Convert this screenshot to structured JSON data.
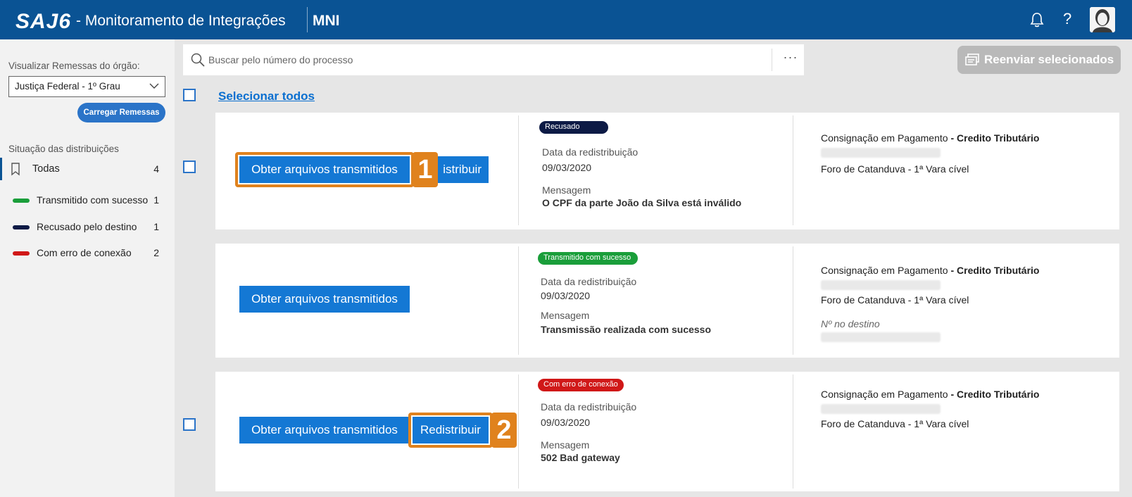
{
  "header": {
    "brand": "SAJ6",
    "title": "- Monitoramento de Integrações",
    "app_code": "MNI",
    "help_label": "?"
  },
  "sidebar": {
    "org_label": "Visualizar Remessas do órgão:",
    "org_value": "Justiça Federal - 1º Grau",
    "load_button": "Carregar Remessas",
    "status_label": "Situação das distribuições",
    "filters": [
      {
        "label": "Todas",
        "count": "4",
        "color": ""
      },
      {
        "label": "Transmitido com sucesso",
        "count": "1",
        "color": "#1a9e3a"
      },
      {
        "label": "Recusado pelo destino",
        "count": "1",
        "color": "#0d1a45"
      },
      {
        "label": "Com erro de conexão",
        "count": "2",
        "color": "#d01818"
      }
    ]
  },
  "search": {
    "placeholder": "Buscar pelo número do processo",
    "more_label": "···"
  },
  "toolbar": {
    "resend_label": "Reenviar selecionados"
  },
  "list": {
    "select_all": "Selecionar todos",
    "items": [
      {
        "obtain_label": "Obter arquivos transmitidos",
        "redistribute_label": "Redistribuir",
        "redistribute_visible_text": "istribuir",
        "callout_number": "1",
        "status_badge": "Recusado",
        "status_color": "#0d1a45",
        "date_label": "Data da redistribuição",
        "date_value": "09/03/2020",
        "message_label": "Mensagem",
        "message_value": "O CPF da parte João da Silva está inválido",
        "class_name": "Consignação em Pagamento",
        "class_subject": "- Credito Tributário",
        "court": "Foro de Catanduva - 1ª Vara cível"
      },
      {
        "obtain_label": "Obter arquivos transmitidos",
        "status_badge": "Transmitido com sucesso",
        "status_color": "#1a9e3a",
        "date_label": "Data da redistribuição",
        "date_value": "09/03/2020",
        "message_label": "Mensagem",
        "message_value": "Transmissão realizada com sucesso",
        "class_name": "Consignação em Pagamento",
        "class_subject": "- Credito Tributário",
        "court": "Foro de Catanduva - 1ª Vara cível",
        "dest_label": "Nº no destino"
      },
      {
        "obtain_label": "Obter arquivos transmitidos",
        "redistribute_label": "Redistribuir",
        "callout_number": "2",
        "status_badge": "Com erro de conexão",
        "status_color": "#d01818",
        "date_label": "Data da redistribuição",
        "date_value": "09/03/2020",
        "message_label": "Mensagem",
        "message_value": "502 Bad gateway",
        "class_name": "Consignação em Pagamento",
        "class_subject": "- Credito Tributário",
        "court": "Foro de Catanduva - 1ª Vara cível"
      }
    ]
  }
}
